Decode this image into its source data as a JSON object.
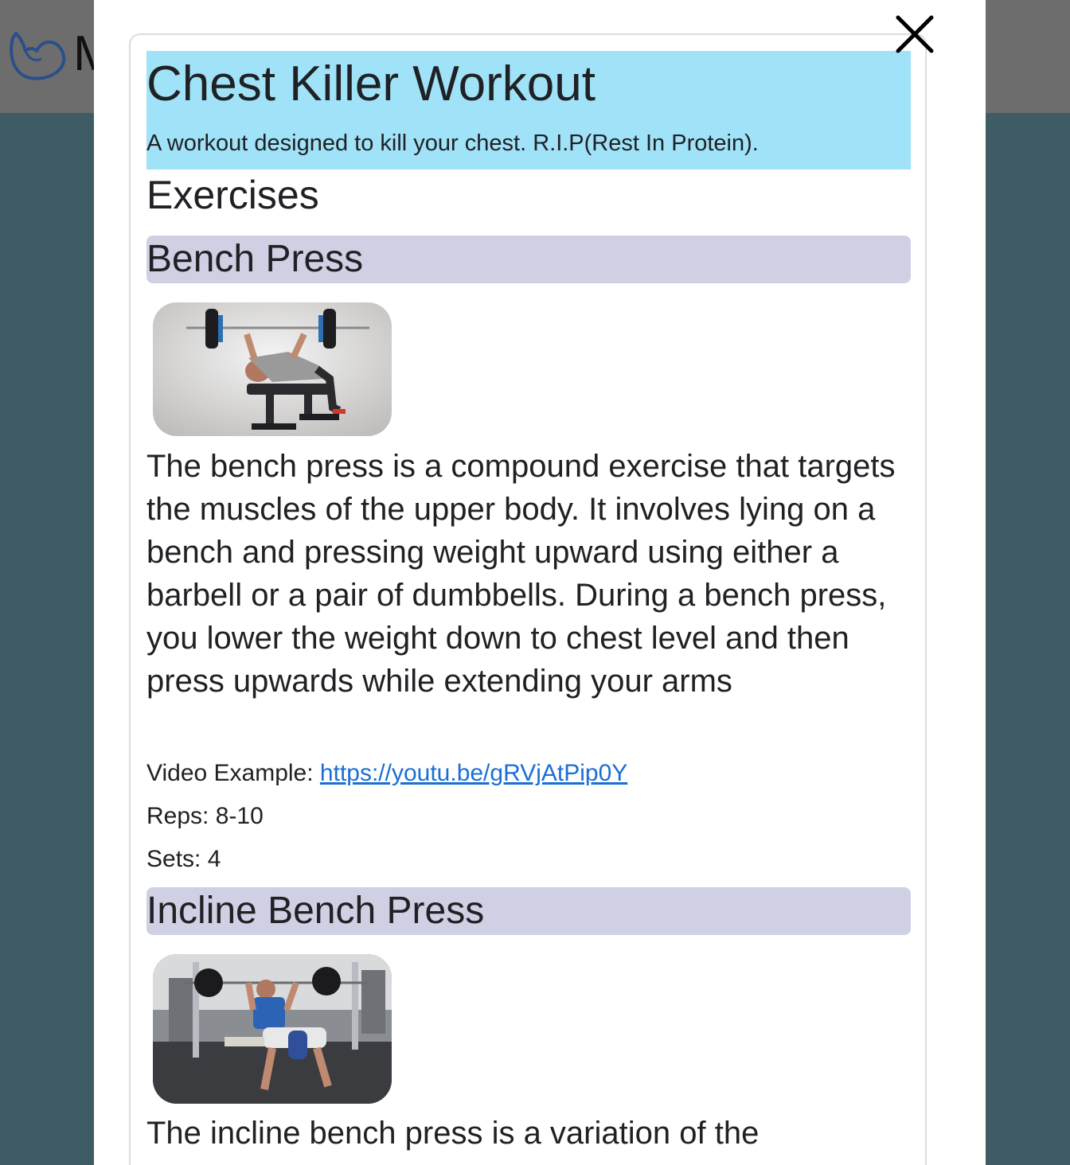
{
  "background": {
    "brand_initial": "M"
  },
  "modal": {
    "close_icon": "close-icon",
    "workout": {
      "title": "Chest Killer Workout",
      "description": "A workout designed to kill your chest. R.I.P(Rest In Protein)."
    },
    "exercises_heading": "Exercises",
    "exercises": [
      {
        "name": "Bench Press",
        "image": "bench-press-photo",
        "description": "The bench press is a compound exercise that targets the muscles of the upper body. It involves lying on a bench and pressing weight upward using either a barbell or a pair of dumbbells. During a bench press, you lower the weight down to chest level and then press upwards while extending your arms",
        "video_label": "Video Example: ",
        "video_url": "https://youtu.be/gRVjAtPip0Y",
        "reps_label": "Reps: 8-10",
        "sets_label": "Sets: 4"
      },
      {
        "name": "Incline Bench Press",
        "image": "incline-bench-press-photo",
        "description": "The incline bench press is a variation of the"
      }
    ]
  },
  "colors": {
    "header_bg": "#a0e2f8",
    "exercise_name_bg": "#cfd0e3",
    "link": "#1a6fd6",
    "backdrop": "#3f5c65"
  }
}
